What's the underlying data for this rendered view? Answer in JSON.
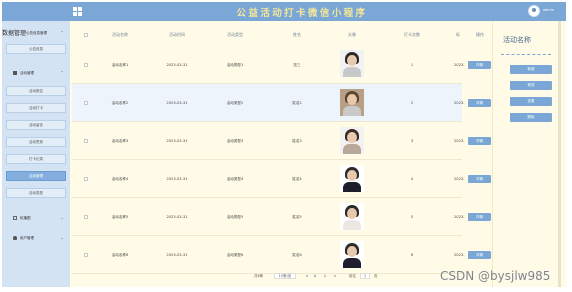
{
  "header": {
    "app_title": "公益活动打卡微信小程序",
    "username": "admin"
  },
  "sidebar": {
    "home_label": "系统首页",
    "ghost_label": "数据管理",
    "groups": [
      {
        "label": "公告信息管理",
        "icon": "bell-icon"
      },
      {
        "label": "活动管理",
        "icon": "grid-icon"
      },
      {
        "label": "轮播图",
        "icon": "image-icon"
      },
      {
        "label": "用户管理",
        "icon": "person-icon"
      }
    ],
    "items": [
      {
        "label": "公告信息"
      },
      {
        "label": "活动报名"
      },
      {
        "label": "活动打卡"
      },
      {
        "label": "活动留言"
      },
      {
        "label": "活动签到"
      },
      {
        "label": "打卡记录"
      },
      {
        "label": "活动管理",
        "active": true
      },
      {
        "label": "活动类型"
      }
    ]
  },
  "table": {
    "headers": [
      "活动名称",
      "活动时间",
      "活动类型",
      "姓名",
      "头像",
      "打卡次数",
      "操作"
    ],
    "truncated_header": "标",
    "rows": [
      {
        "name": "活动名称1",
        "date": "2023-03-31",
        "type": "活动类型1",
        "person": "张三",
        "count": "1",
        "cut": "2023-",
        "action": "详情"
      },
      {
        "name": "活动名称2",
        "date": "2023-03-31",
        "type": "活动类型2",
        "person": "姓名2",
        "count": "2",
        "cut": "2023-",
        "action": "详情"
      },
      {
        "name": "活动名称3",
        "date": "2023-03-31",
        "type": "活动类型3",
        "person": "姓名3",
        "count": "3",
        "cut": "2023-",
        "action": "详情"
      },
      {
        "name": "活动名称4",
        "date": "2023-03-31",
        "type": "活动类型4",
        "person": "姓名4",
        "count": "4",
        "cut": "2023-",
        "action": "详情"
      },
      {
        "name": "活动名称5",
        "date": "2023-03-31",
        "type": "活动类型5",
        "person": "姓名5",
        "count": "5",
        "cut": "2023-",
        "action": "详情"
      },
      {
        "name": "活动名称6",
        "date": "2023-03-31",
        "type": "活动类型6",
        "person": "姓名6",
        "count": "6",
        "cut": "2023-",
        "action": "详情"
      }
    ]
  },
  "pagination": {
    "total": "共6条",
    "page_size": "10条/页",
    "prev": "<",
    "pages": [
      "1",
      "2"
    ],
    "next": ">",
    "goto_label": "前往",
    "goto_value": "1",
    "page_suffix": "页"
  },
  "panel": {
    "title": "活动名称",
    "buttons": [
      "新增",
      "修改",
      "查看",
      "删除"
    ]
  },
  "watermark": "CSDN @bysjlw985",
  "colors": {
    "accent": "#7aa7d6",
    "title": "#f4e59a",
    "background": "#fffbe6",
    "sidebar": "#d3e3f4"
  }
}
